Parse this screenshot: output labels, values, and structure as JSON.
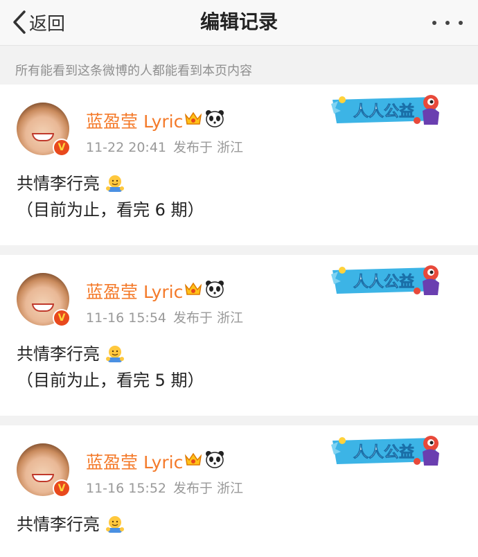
{
  "nav": {
    "back_label": "返回",
    "title": "编辑记录"
  },
  "notice": "所有能看到这条微博的人都能看到本页内容",
  "user": {
    "name": "蓝盈莹 Lyric",
    "verified_badge": "V"
  },
  "banner": {
    "label": "人人公益"
  },
  "records": [
    {
      "time": "11-22 20:41",
      "location": "发布于 浙江",
      "line1": "共情李行亮",
      "line2": "（目前为止，看完 6 期）"
    },
    {
      "time": "11-16 15:54",
      "location": "发布于 浙江",
      "line1": "共情李行亮",
      "line2": "（目前为止，看完 5 期）"
    },
    {
      "time": "11-16 15:52",
      "location": "发布于 浙江",
      "line1": "共情李行亮",
      "line2": ""
    }
  ],
  "icons": {
    "back": "chevron-left-icon",
    "more": "more-dots-icon",
    "crown": "crown-icon",
    "panda": "panda-icon",
    "emoji": "hug-emoji-icon"
  },
  "colors": {
    "username": "#f47a2a",
    "meta": "#999999",
    "notice": "#8f8f8f",
    "badge": "#e8491d"
  }
}
